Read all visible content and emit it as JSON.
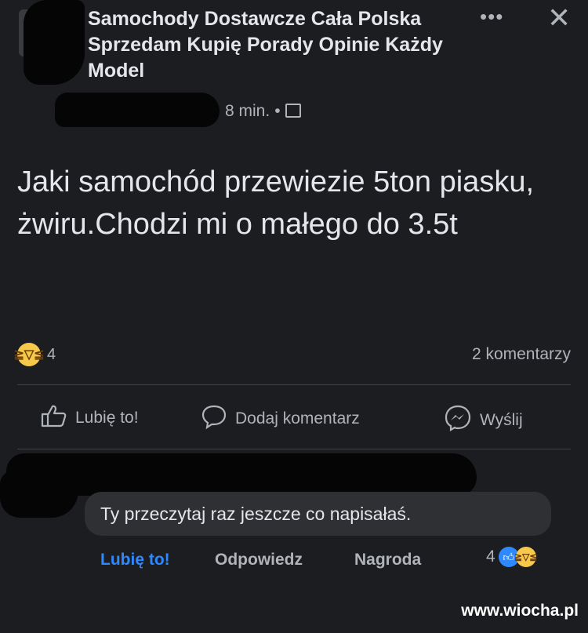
{
  "post": {
    "group_name": "Samochody Dostawcze Cała Polska Sprzedam Kupię Porady Opinie Każdy Model",
    "time": "8 min.",
    "separator": "•",
    "text": "Jaki samochód przewiezie 5ton piasku, żwiru.Chodzi mi o małego do 3.5t",
    "reaction_count": "4",
    "comments_count": "2 komentarzy"
  },
  "actions": {
    "like": "Lubię to!",
    "comment": "Dodaj komentarz",
    "send": "Wyślij"
  },
  "comment": {
    "text": "Ty przeczytaj raz jeszcze co napisałaś.",
    "like": "Lubię to!",
    "reply": "Odpowiedz",
    "award": "Nagroda",
    "reaction_count": "4"
  },
  "watermark": "www.wiocha.pl",
  "icons": {
    "more": "more-options-icon",
    "close": "close-icon",
    "privacy": "group-privacy-icon",
    "like": "thumbs-up-icon",
    "comment": "comment-bubble-icon",
    "send": "messenger-icon"
  },
  "colors": {
    "background": "#1c1d21",
    "text": "#e4e6eb",
    "secondary": "#b0b3b8",
    "accent_blue": "#2e89ff",
    "emoji": "#f7c94b"
  }
}
